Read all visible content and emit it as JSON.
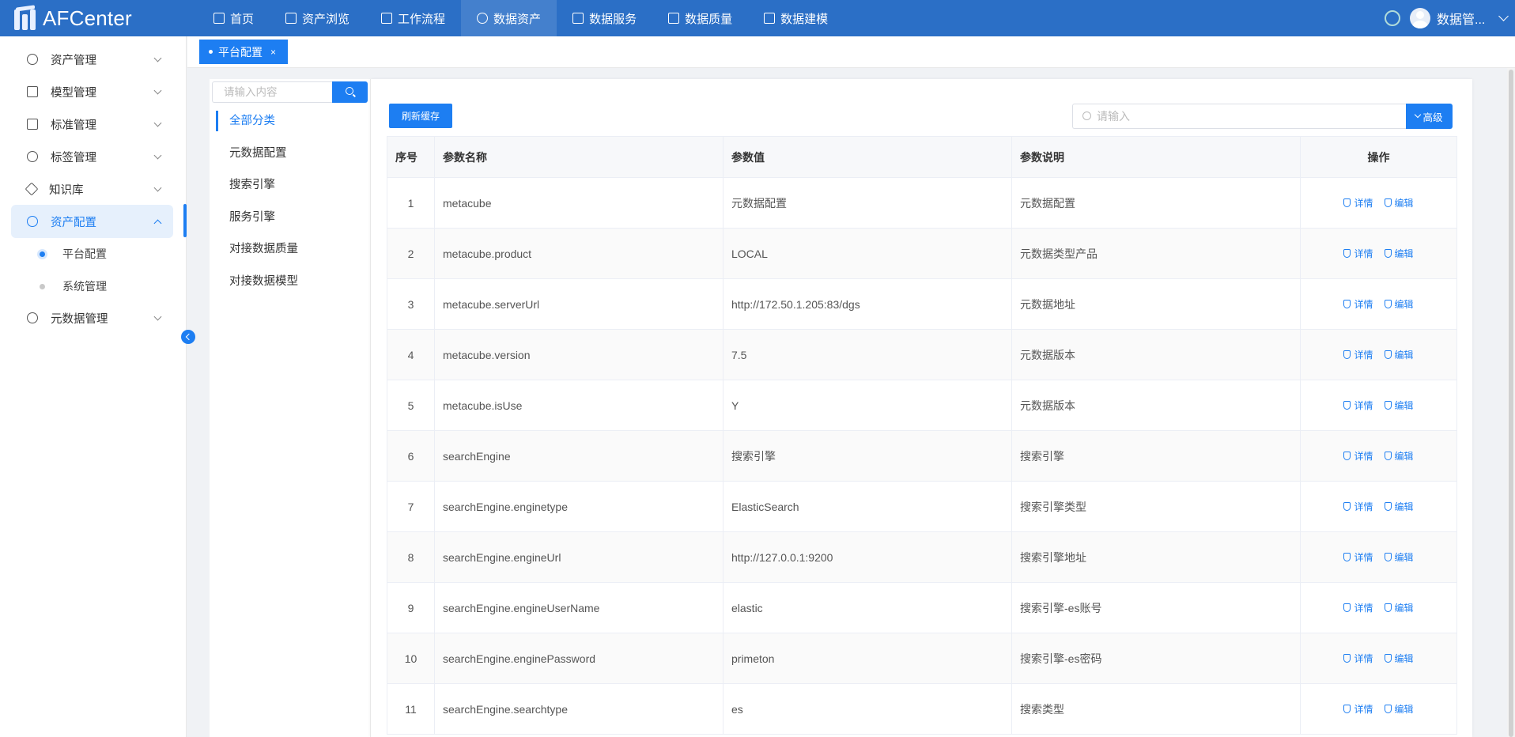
{
  "app": {
    "logo_text": "AFCenter",
    "user_name": "数据管..."
  },
  "top_nav": [
    {
      "label": "首页",
      "icon": "document-icon"
    },
    {
      "label": "资产浏览",
      "icon": "list-icon"
    },
    {
      "label": "工作流程",
      "icon": "scale-icon"
    },
    {
      "label": "数据资产",
      "icon": "chat-icon",
      "active": true
    },
    {
      "label": "数据服务",
      "icon": "activity-icon"
    },
    {
      "label": "数据质量",
      "icon": "bar-chart-icon"
    },
    {
      "label": "数据建模",
      "icon": "layers-icon"
    }
  ],
  "sidebar": {
    "items": [
      {
        "label": "资产管理",
        "icon": "clock-icon"
      },
      {
        "label": "模型管理",
        "icon": "trend-icon"
      },
      {
        "label": "标准管理",
        "icon": "doc-list-icon"
      },
      {
        "label": "标签管理",
        "icon": "plus-circle-icon"
      },
      {
        "label": "知识库",
        "icon": "tag-icon"
      },
      {
        "label": "资产配置",
        "icon": "target-icon",
        "active": true
      },
      {
        "label": "元数据管理",
        "icon": "layers-icon"
      }
    ],
    "sub_items": [
      {
        "label": "平台配置",
        "selected": true
      },
      {
        "label": "系统管理",
        "selected": false
      }
    ]
  },
  "tabs": [
    {
      "label": "平台配置",
      "close": "×"
    }
  ],
  "category": {
    "search_placeholder": "请输入内容",
    "items": [
      "全部分类",
      "元数据配置",
      "搜索引擎",
      "服务引擎",
      "对接数据质量",
      "对接数据模型"
    ],
    "active_index": 0
  },
  "toolbar": {
    "refresh_label": "刷新缓存",
    "filter_placeholder": "请输入",
    "advanced_label": "高级"
  },
  "table": {
    "columns": [
      "序号",
      "参数名称",
      "参数值",
      "参数说明",
      "操作"
    ],
    "action_labels": {
      "detail": "详情",
      "edit": "编辑"
    },
    "rows": [
      {
        "idx": "1",
        "name": "metacube",
        "value": "元数据配置",
        "desc": "元数据配置"
      },
      {
        "idx": "2",
        "name": "metacube.product",
        "value": "LOCAL",
        "desc": "元数据类型产品"
      },
      {
        "idx": "3",
        "name": "metacube.serverUrl",
        "value": "http://172.50.1.205:83/dgs",
        "desc": "元数据地址"
      },
      {
        "idx": "4",
        "name": "metacube.version",
        "value": "7.5",
        "desc": "元数据版本"
      },
      {
        "idx": "5",
        "name": "metacube.isUse",
        "value": "Y",
        "desc": "元数据版本"
      },
      {
        "idx": "6",
        "name": "searchEngine",
        "value": "搜索引擎",
        "desc": "搜索引擎"
      },
      {
        "idx": "7",
        "name": "searchEngine.enginetype",
        "value": "ElasticSearch",
        "desc": "搜索引擎类型"
      },
      {
        "idx": "8",
        "name": "searchEngine.engineUrl",
        "value": "http://127.0.0.1:9200",
        "desc": "搜索引擎地址"
      },
      {
        "idx": "9",
        "name": "searchEngine.engineUserName",
        "value": "elastic",
        "desc": "搜索引擎-es账号"
      },
      {
        "idx": "10",
        "name": "searchEngine.enginePassword",
        "value": "primeton",
        "desc": "搜索引擎-es密码"
      },
      {
        "idx": "11",
        "name": "searchEngine.searchtype",
        "value": "es",
        "desc": "搜索类型"
      }
    ]
  },
  "colors": {
    "topbar": "#2b6fc6",
    "accent": "#1d7ef2",
    "active_bg": "#e6f0fc"
  }
}
